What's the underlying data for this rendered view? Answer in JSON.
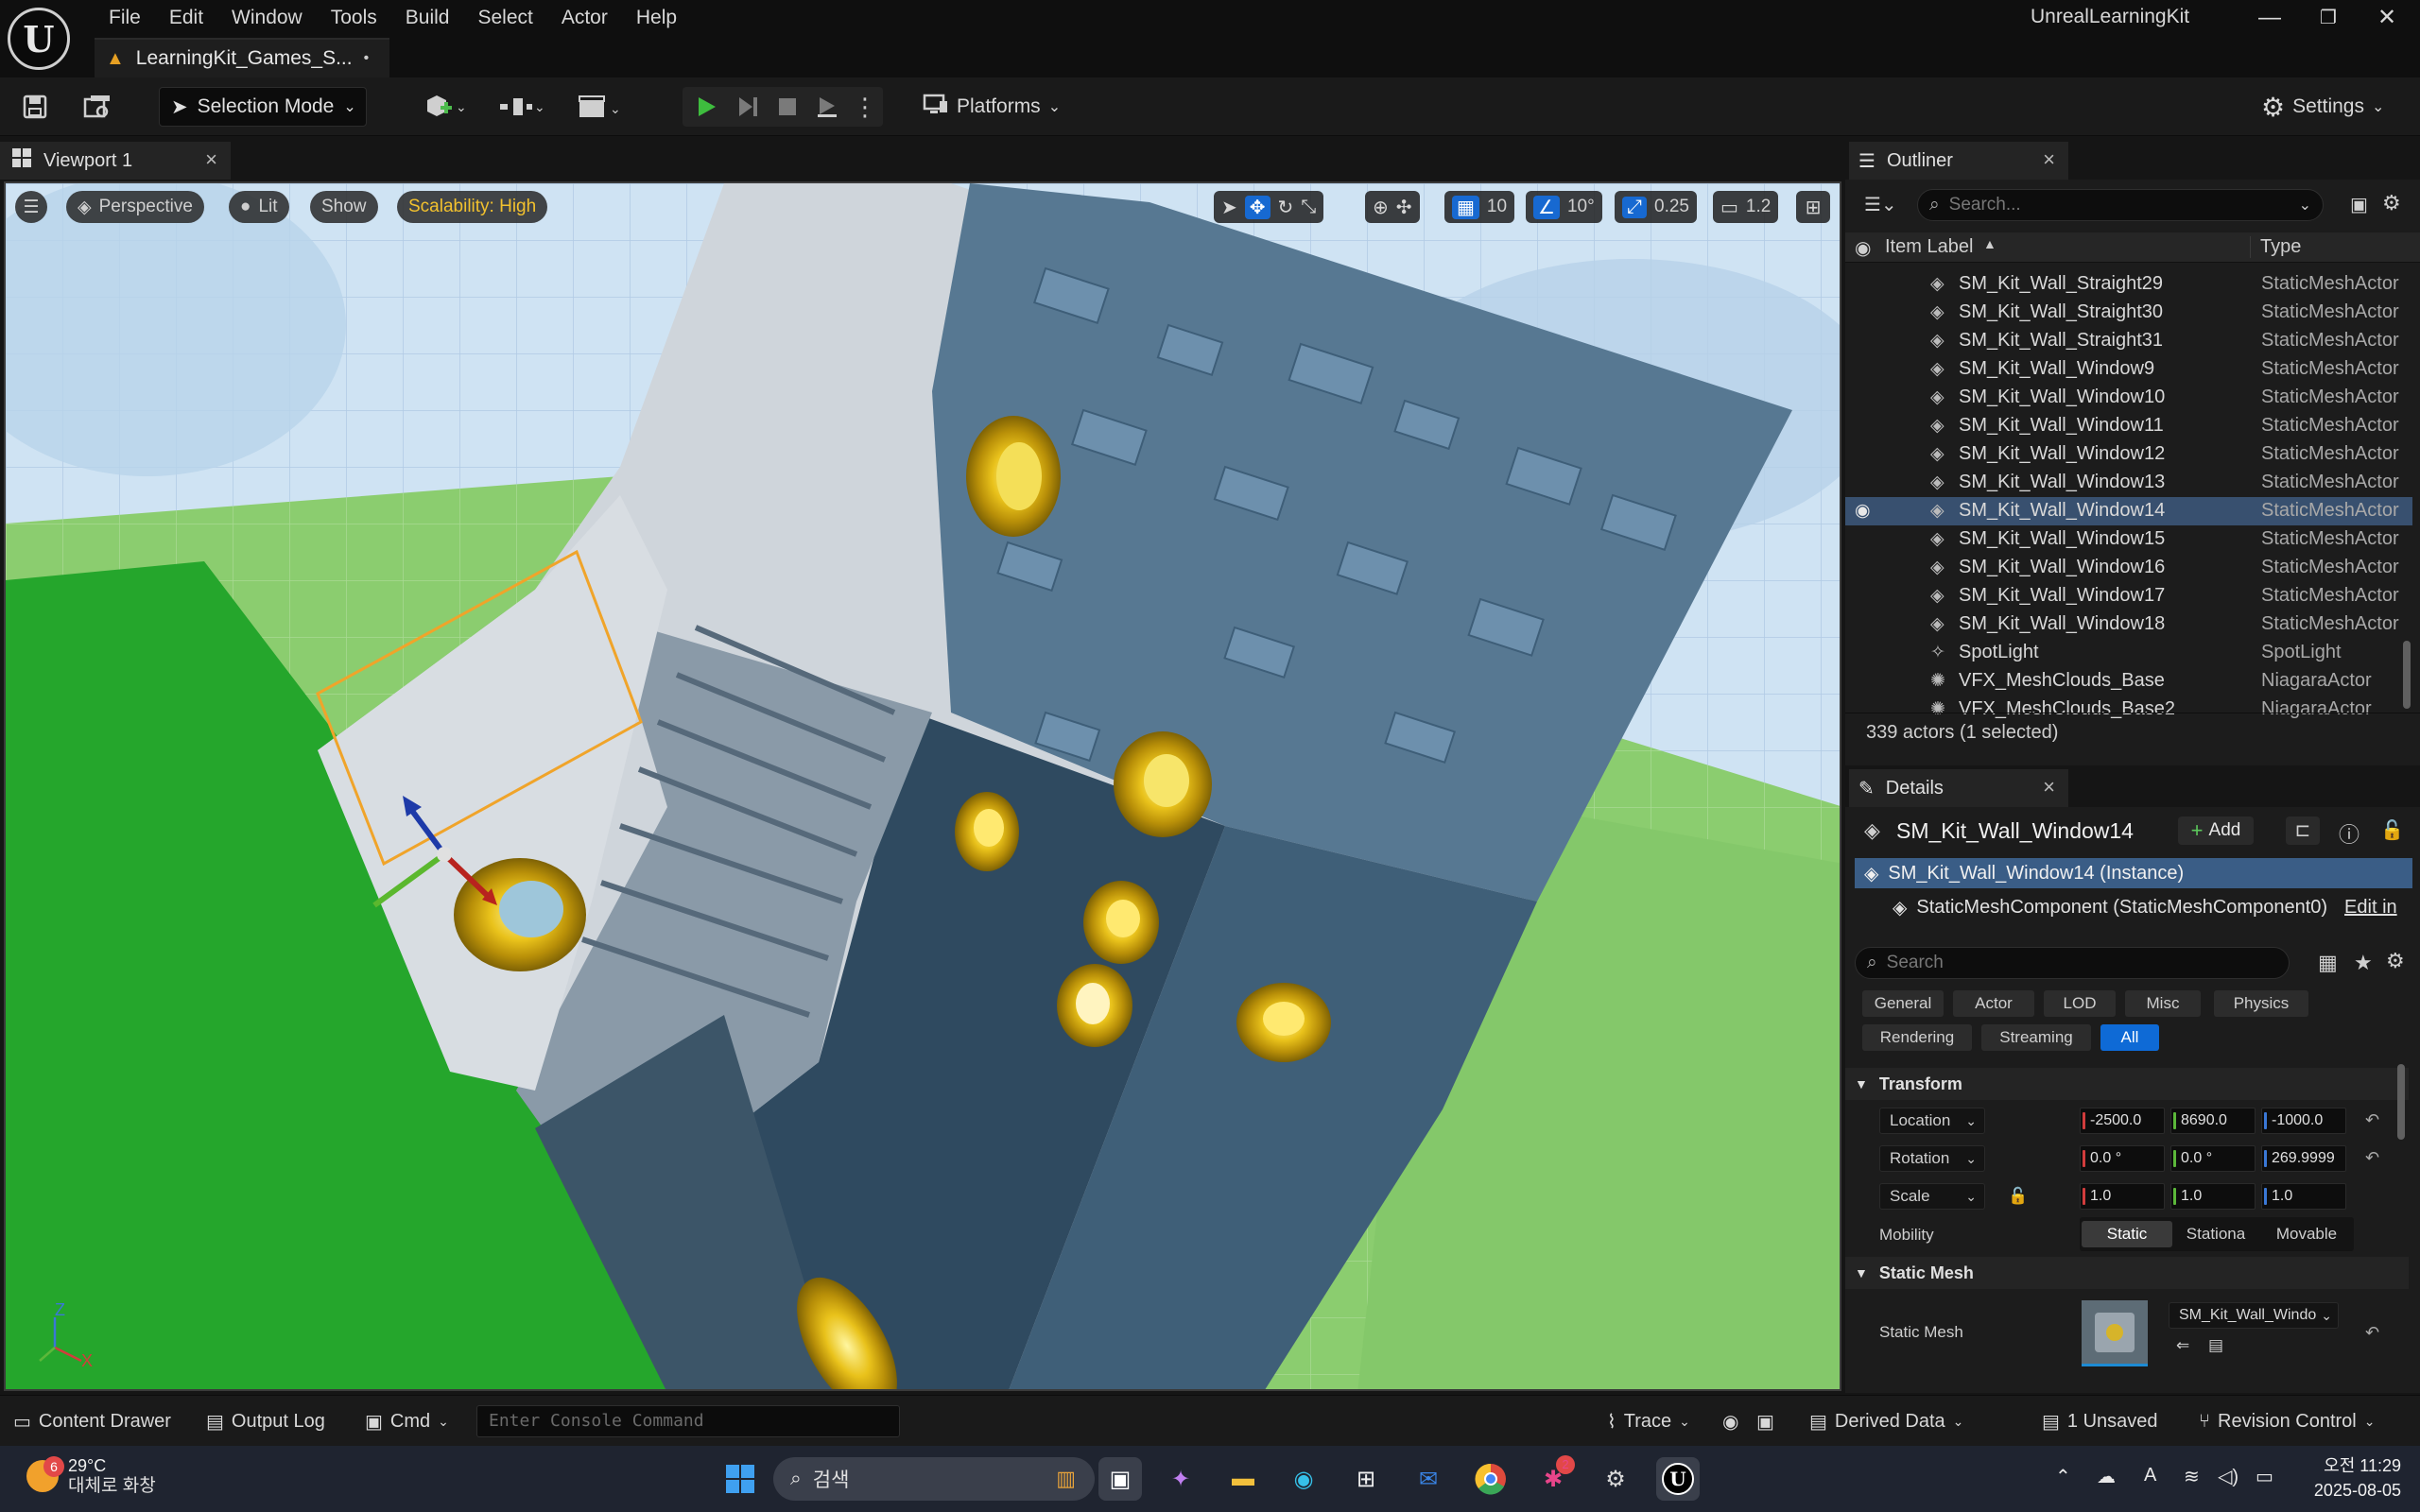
{
  "menu": [
    "File",
    "Edit",
    "Window",
    "Tools",
    "Build",
    "Select",
    "Actor",
    "Help"
  ],
  "project_tab": {
    "title": "LearningKit_Games_S...",
    "modified_marker": "•"
  },
  "app_title": "UnrealLearningKit",
  "toolbar": {
    "selection_mode": "Selection Mode",
    "platforms": "Platforms",
    "settings": "Settings"
  },
  "viewport": {
    "tab_label": "Viewport 1",
    "perspective": "Perspective",
    "lit": "Lit",
    "show": "Show",
    "scalability": "Scalability: High",
    "grid_snap": "10",
    "rotation_snap": "10°",
    "scale_snap": "0.25",
    "camera_speed": "1.2",
    "axis_z": "Z",
    "axis_x": "X"
  },
  "outliner": {
    "tab_label": "Outliner",
    "search_placeholder": "Search...",
    "col_label": "Item Label",
    "col_type": "Type",
    "rows": [
      {
        "label": "SM_Kit_Wall_Straight29",
        "type": "StaticMeshActor",
        "selected": false
      },
      {
        "label": "SM_Kit_Wall_Straight30",
        "type": "StaticMeshActor",
        "selected": false
      },
      {
        "label": "SM_Kit_Wall_Straight31",
        "type": "StaticMeshActor",
        "selected": false
      },
      {
        "label": "SM_Kit_Wall_Window9",
        "type": "StaticMeshActor",
        "selected": false
      },
      {
        "label": "SM_Kit_Wall_Window10",
        "type": "StaticMeshActor",
        "selected": false
      },
      {
        "label": "SM_Kit_Wall_Window11",
        "type": "StaticMeshActor",
        "selected": false
      },
      {
        "label": "SM_Kit_Wall_Window12",
        "type": "StaticMeshActor",
        "selected": false
      },
      {
        "label": "SM_Kit_Wall_Window13",
        "type": "StaticMeshActor",
        "selected": false
      },
      {
        "label": "SM_Kit_Wall_Window14",
        "type": "StaticMeshActor",
        "selected": true
      },
      {
        "label": "SM_Kit_Wall_Window15",
        "type": "StaticMeshActor",
        "selected": false
      },
      {
        "label": "SM_Kit_Wall_Window16",
        "type": "StaticMeshActor",
        "selected": false
      },
      {
        "label": "SM_Kit_Wall_Window17",
        "type": "StaticMeshActor",
        "selected": false
      },
      {
        "label": "SM_Kit_Wall_Window18",
        "type": "StaticMeshActor",
        "selected": false
      },
      {
        "label": "SpotLight",
        "type": "SpotLight",
        "selected": false
      },
      {
        "label": "VFX_MeshClouds_Base",
        "type": "NiagaraActor",
        "selected": false
      },
      {
        "label": "VFX_MeshClouds_Base2",
        "type": "NiagaraActor",
        "selected": false
      }
    ],
    "status": "339 actors (1 selected)"
  },
  "details": {
    "tab_label": "Details",
    "actor_name": "SM_Kit_Wall_Window14",
    "add_label": "Add",
    "instance_label": "SM_Kit_Wall_Window14 (Instance)",
    "component_label": "StaticMeshComponent (StaticMeshComponent0)",
    "edit_link": "Edit in",
    "search_placeholder": "Search",
    "filters": [
      "General",
      "Actor",
      "LOD",
      "Misc",
      "Physics",
      "Rendering",
      "Streaming",
      "All"
    ],
    "active_filter": "All",
    "transform_section": "Transform",
    "location_label": "Location",
    "location": [
      "-2500.0",
      "8690.0",
      "-1000.0"
    ],
    "rotation_label": "Rotation",
    "rotation": [
      "0.0 °",
      "0.0 °",
      "269.9999"
    ],
    "scale_label": "Scale",
    "scale": [
      "1.0",
      "1.0",
      "1.0"
    ],
    "mobility_label": "Mobility",
    "mobility_options": [
      "Static",
      "Stationa",
      "Movable"
    ],
    "mobility_selected": "Static",
    "static_mesh_section": "Static Mesh",
    "static_mesh_label": "Static Mesh",
    "static_mesh_value": "SM_Kit_Wall_Windo"
  },
  "statusbar": {
    "content_drawer": "Content Drawer",
    "output_log": "Output Log",
    "cmd": "Cmd",
    "console_placeholder": "Enter Console Command",
    "trace": "Trace",
    "derived_data": "Derived Data",
    "unsaved": "1 Unsaved",
    "revision_control": "Revision Control"
  },
  "taskbar": {
    "weather_temp": "29°C",
    "weather_desc": "대체로 화창",
    "weather_badge": "6",
    "search_label": "검색",
    "slack_badge": "2",
    "time": "오전 11:29",
    "date": "2025-08-05"
  },
  "colors": {
    "accent_blue": "#0e6ad6",
    "selection_row": "#38506f",
    "scalability_text": "#f2c12e",
    "ground_green": "#86c16c"
  }
}
